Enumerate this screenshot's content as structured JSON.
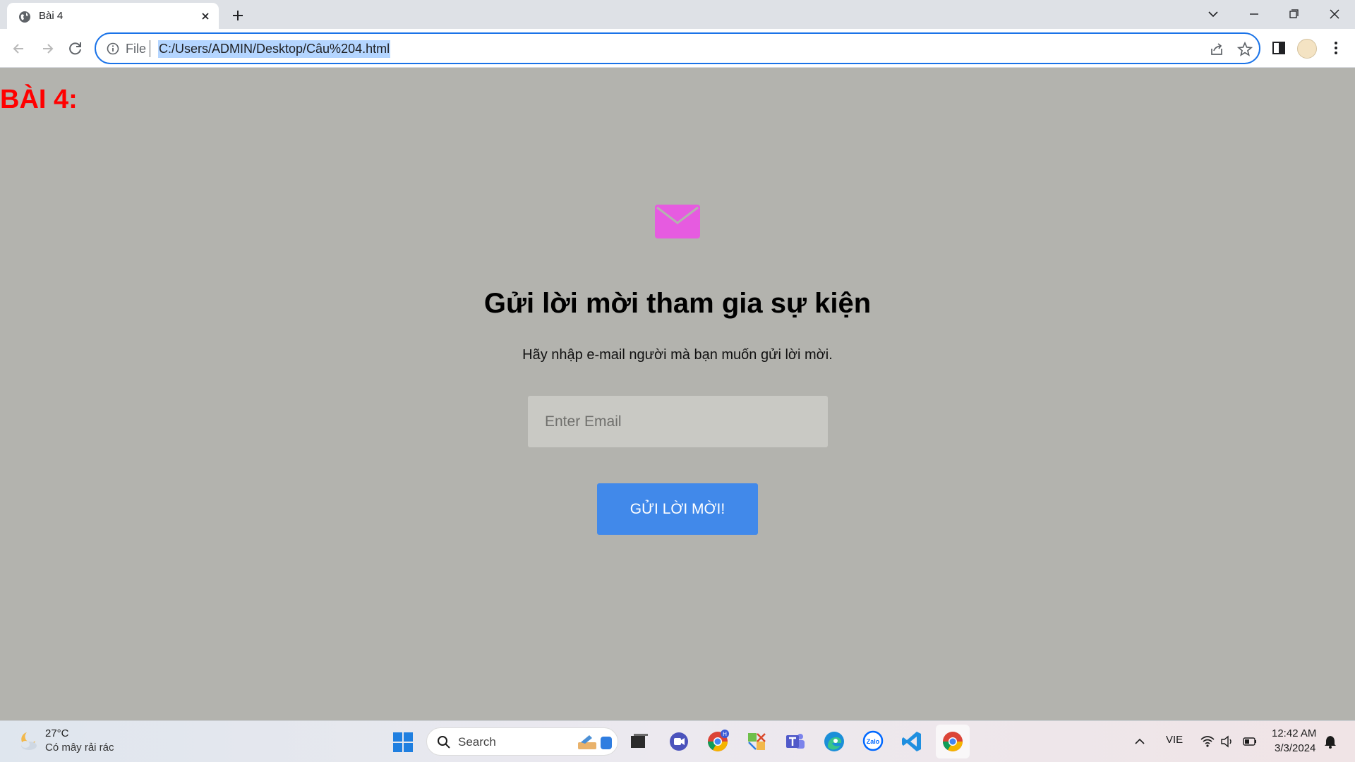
{
  "browser": {
    "tab_title": "Bài 4",
    "scheme_label": "File",
    "url": "C:/Users/ADMIN/Desktop/Câu%204.html"
  },
  "page": {
    "heading": "BÀI 4:",
    "title": "Gửi lời mời tham gia sự kiện",
    "subtitle": "Hãy nhập e-mail người mà bạn muốn gửi lời mời.",
    "email_placeholder": "Enter Email",
    "email_value": "",
    "button_label": "GỬI LỜI MỜI!",
    "colors": {
      "background": "#b3b3ae",
      "heading": "#ff0000",
      "envelope": "#e65be0",
      "button": "#4189ea"
    }
  },
  "taskbar": {
    "weather_temp": "27°C",
    "weather_desc": "Có mây rải rác",
    "search_label": "Search",
    "language": "VIE",
    "time": "12:42 AM",
    "date": "3/3/2024",
    "chrome_badge": "H",
    "zalo_label": "Zalo"
  }
}
